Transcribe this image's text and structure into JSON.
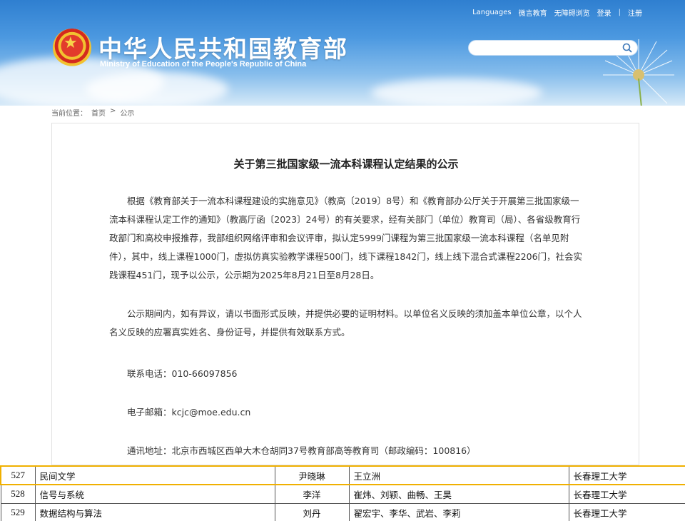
{
  "header": {
    "title": "中华人民共和国教育部",
    "subtitle": "Ministry of Education of the People's Republic of China",
    "top_links": [
      "Languages",
      "微言教育",
      "无障碍浏览",
      "登录",
      "注册"
    ]
  },
  "breadcrumb": {
    "prefix": "当前位置：",
    "items": [
      "首页",
      "公示"
    ],
    "separator": ">"
  },
  "article": {
    "title": "关于第三批国家级一流本科课程认定结果的公示",
    "paragraphs": [
      "根据《教育部关于一流本科课程建设的实施意见》（教高〔2019〕8号）和《教育部办公厅关于开展第三批国家级一流本科课程认定工作的通知》（教高厅函〔2023〕24号）的有关要求，经有关部门（单位）教育司（局）、各省级教育行政部门和高校申报推荐，我部组织网络评审和会议评审，拟认定5999门课程为第三批国家级一流本科课程（名单见附件），其中，线上课程1000门，虚拟仿真实验教学课程500门，线下课程1842门，线上线下混合式课程2206门，社会实践课程451门，现予以公示，公示期为2025年8月21日至8月28日。",
      "公示期间内，如有异议，请以书面形式反映，并提供必要的证明材料。以单位名义反映的须加盖本单位公章，以个人名义反映的应署真实姓名、身份证号，并提供有效联系方式。"
    ],
    "phone": "联系电话：010-66097856",
    "email": "电子邮箱：kcjc@moe.edu.cn",
    "address": "通讯地址：北京市西城区西单大木仓胡同37号教育部高等教育司（邮政编码：100816）"
  },
  "table": {
    "rows": [
      {
        "no": "527",
        "course": "民间文学",
        "leader": "尹晓琳",
        "members": "王立洲",
        "school": "长春理工大学",
        "highlighted": true
      },
      {
        "no": "528",
        "course": "信号与系统",
        "leader": "李洋",
        "members": "崔炜、刘颖、曲畅、王昊",
        "school": "长春理工大学",
        "highlighted": false
      },
      {
        "no": "529",
        "course": "数据结构与算法",
        "leader": "刘丹",
        "members": "翟宏宇、李华、武岩、李莉",
        "school": "长春理工大学",
        "highlighted": false
      }
    ]
  },
  "colors": {
    "header_blue": "#2f7fd0",
    "highlight": "#f0b000",
    "emblem_red": "#e23b2c"
  },
  "icons": {
    "search": "search-icon",
    "emblem": "national-emblem-icon"
  }
}
